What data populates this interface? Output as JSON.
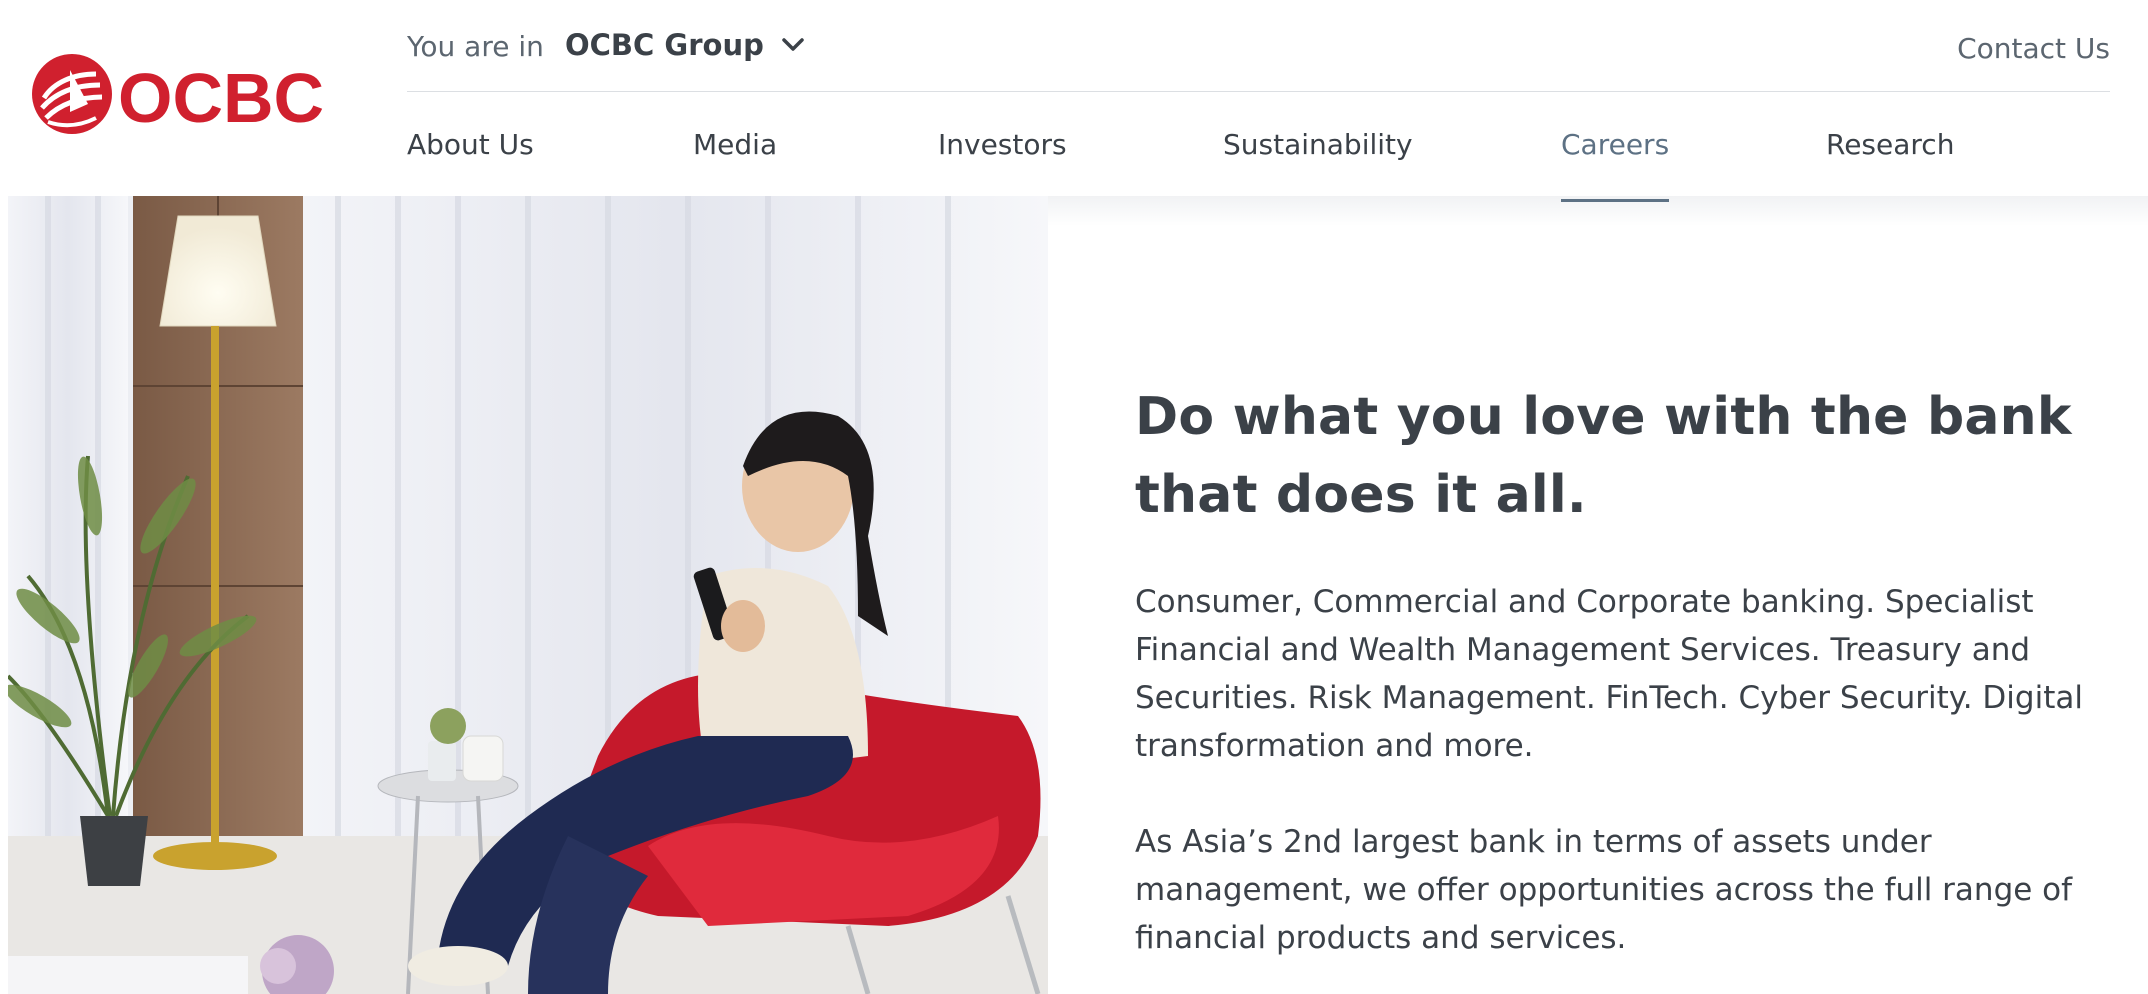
{
  "brand": {
    "name": "OCBC",
    "color": "#d0202e"
  },
  "topbar": {
    "you_are_in_label": "You are in",
    "group_selector_value": "OCBC Group",
    "contact_label": "Contact Us"
  },
  "nav": {
    "items": [
      {
        "label": "About Us",
        "active": false
      },
      {
        "label": "Media",
        "active": false
      },
      {
        "label": "Investors",
        "active": false
      },
      {
        "label": "Sustainability",
        "active": false
      },
      {
        "label": "Careers",
        "active": true
      },
      {
        "label": "Research",
        "active": false
      }
    ],
    "active_color": "#5d7184"
  },
  "hero": {
    "headline": "Do what you love with the bank that does it all.",
    "paragraphs": [
      "Consumer, Commercial and Corporate banking. Specialist Financial and Wealth Management Services. Treasury and Securities. Risk Management. FinTech. Cyber Security. Digital transformation and more.",
      "As Asia’s 2nd largest bank in terms of assets under management, we offer opportunities across the full range of financial products and services."
    ]
  },
  "icons": {
    "logo": "ocbc-logo-icon",
    "dropdown": "chevron-down-icon"
  }
}
